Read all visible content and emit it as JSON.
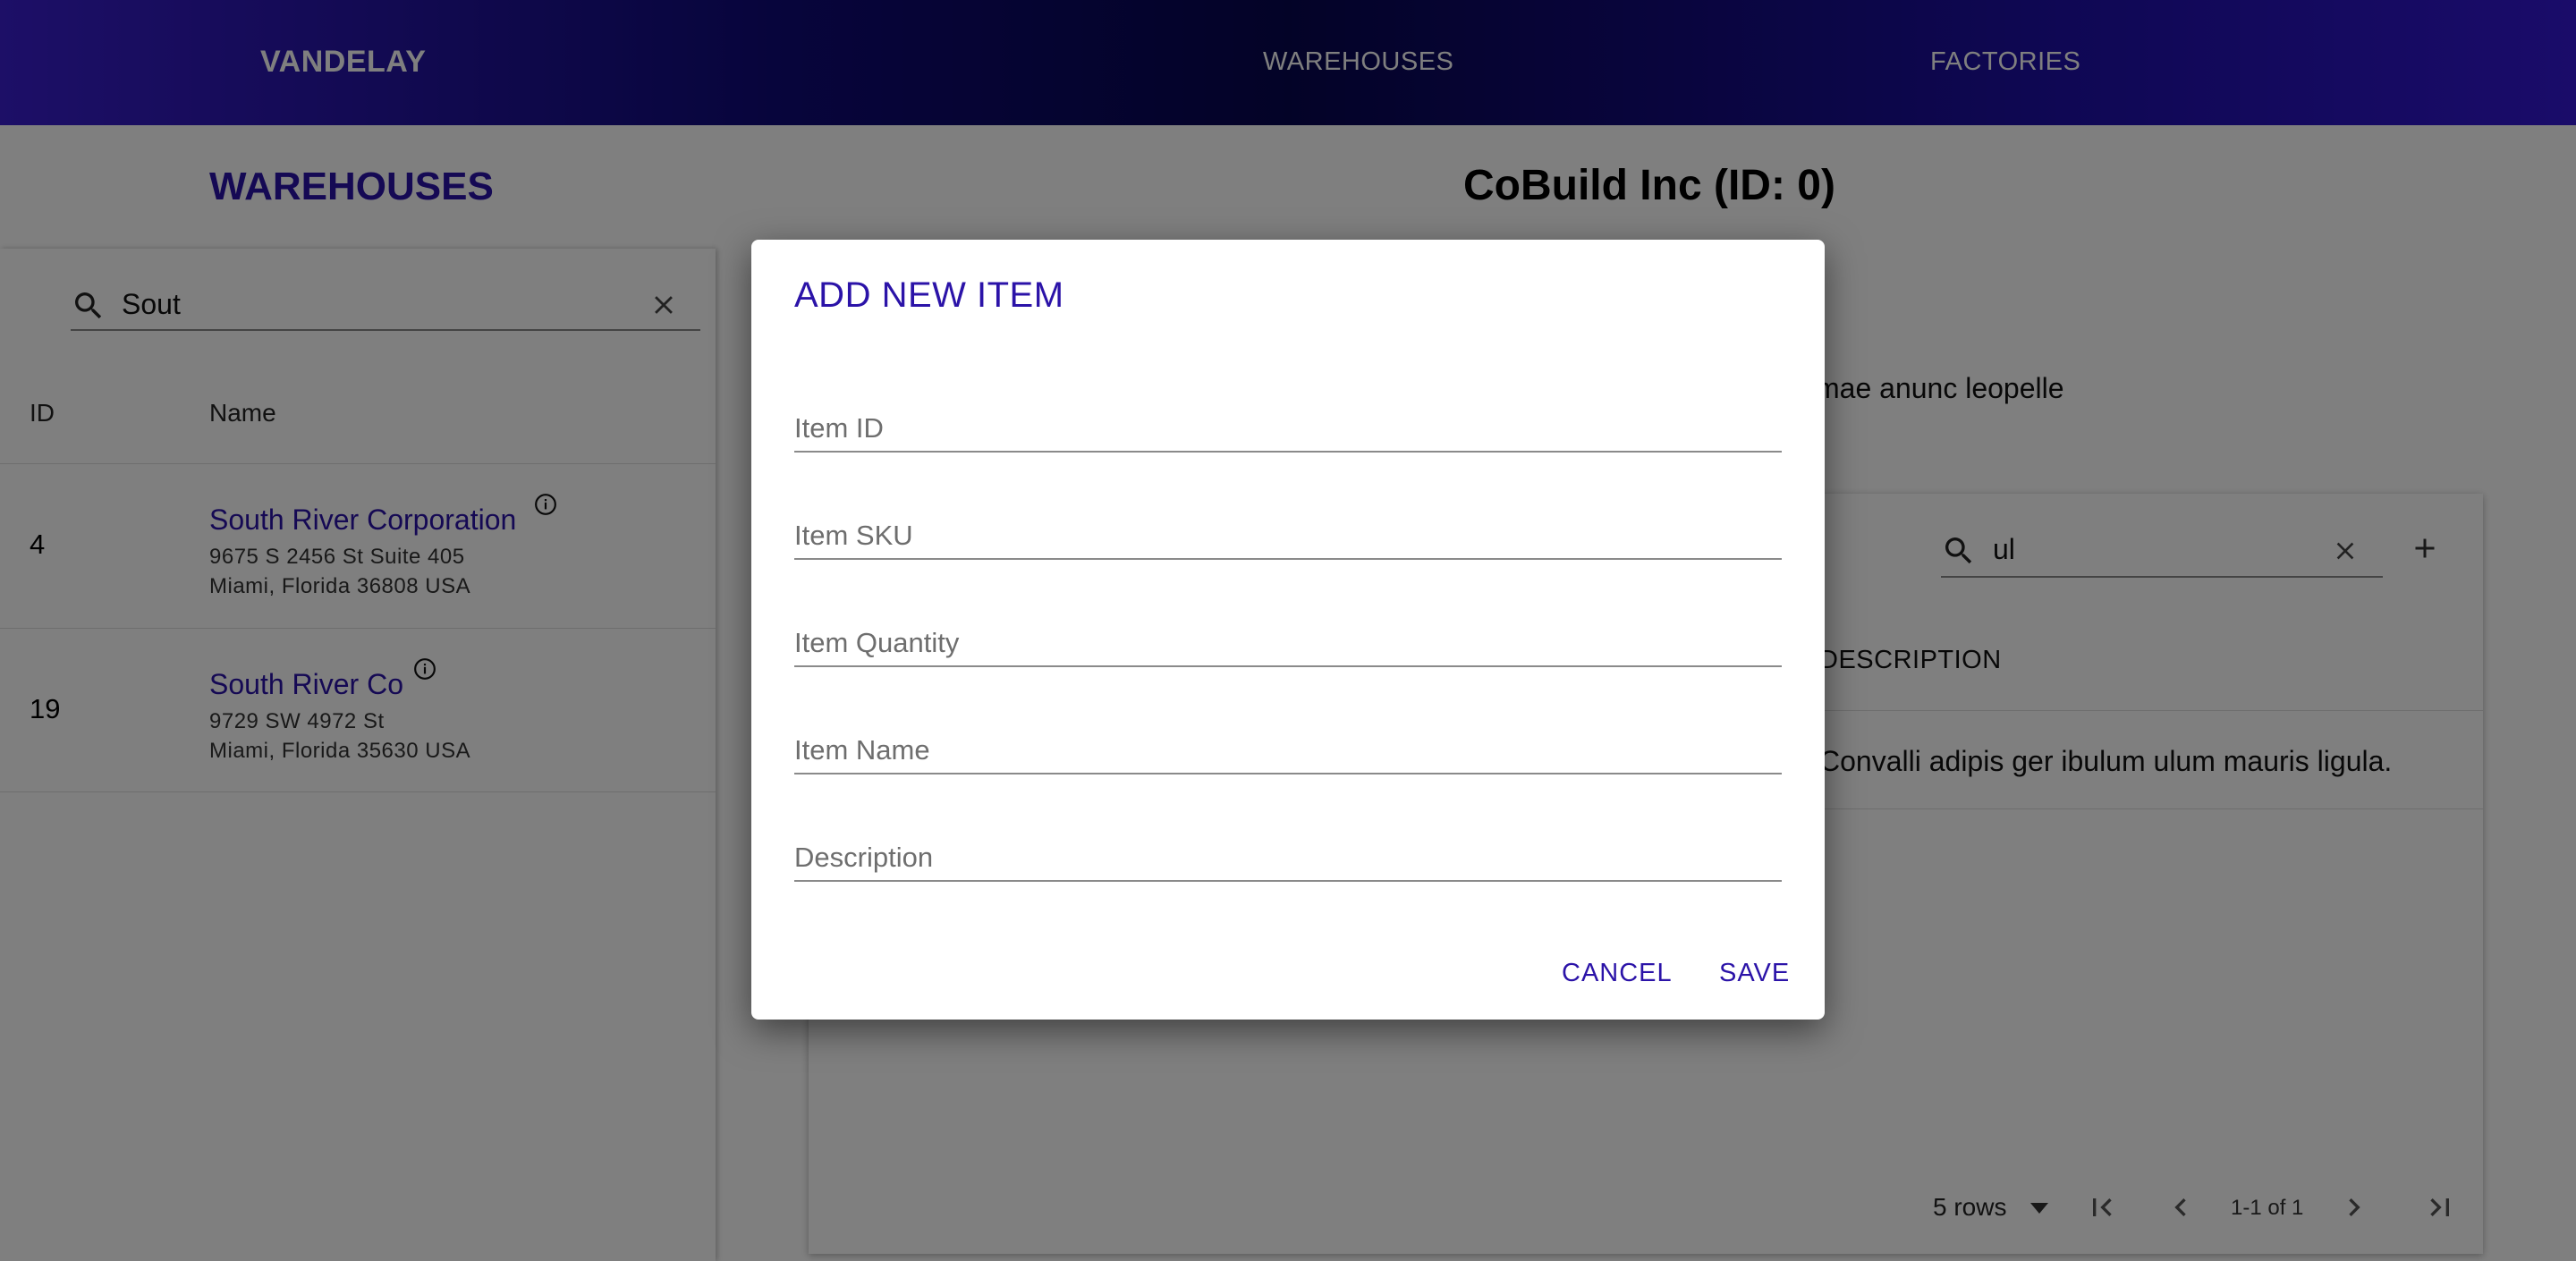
{
  "header": {
    "brand": "VANDELAY",
    "nav": [
      {
        "label": "WAREHOUSES"
      },
      {
        "label": "FACTORIES"
      }
    ]
  },
  "left": {
    "title": "WAREHOUSES",
    "search": {
      "value": "Sout"
    },
    "columns": {
      "id": "ID",
      "name": "Name"
    },
    "rows": [
      {
        "id": "4",
        "name": "South River Corporation",
        "address1": "9675 S 2456 St Suite 405",
        "address2": "Miami, Florida 36808 USA"
      },
      {
        "id": "19",
        "name": "South River Co",
        "address1": "9729 SW 4972 St",
        "address2": "Miami, Florida 35630 USA"
      }
    ]
  },
  "right": {
    "title": "CoBuild Inc (ID: 0)",
    "description_fragment": "mae anunc leopelle",
    "search": {
      "value": "ul"
    },
    "column_description": "DESCRIPTION",
    "row_description": "Convalli adipis ger ibulum ulum mauris ligula.",
    "pagination": {
      "rows_label": "5 rows",
      "range": "1-1 of 1"
    }
  },
  "dialog": {
    "title": "ADD NEW ITEM",
    "fields": [
      {
        "placeholder": "Item ID",
        "value": ""
      },
      {
        "placeholder": "Item SKU",
        "value": ""
      },
      {
        "placeholder": "Item Quantity",
        "value": ""
      },
      {
        "placeholder": "Item Name",
        "value": ""
      },
      {
        "placeholder": "Description",
        "value": ""
      }
    ],
    "cancel_label": "CANCEL",
    "save_label": "SAVE"
  },
  "colors": {
    "primary": "#2b13a8",
    "header_dark": "#07064f",
    "header_light": "#3a1ecf"
  },
  "icons": [
    "search-icon",
    "clear-icon",
    "info-icon",
    "plus-icon",
    "caret-down-icon",
    "first-page-icon",
    "prev-page-icon",
    "next-page-icon",
    "last-page-icon"
  ]
}
